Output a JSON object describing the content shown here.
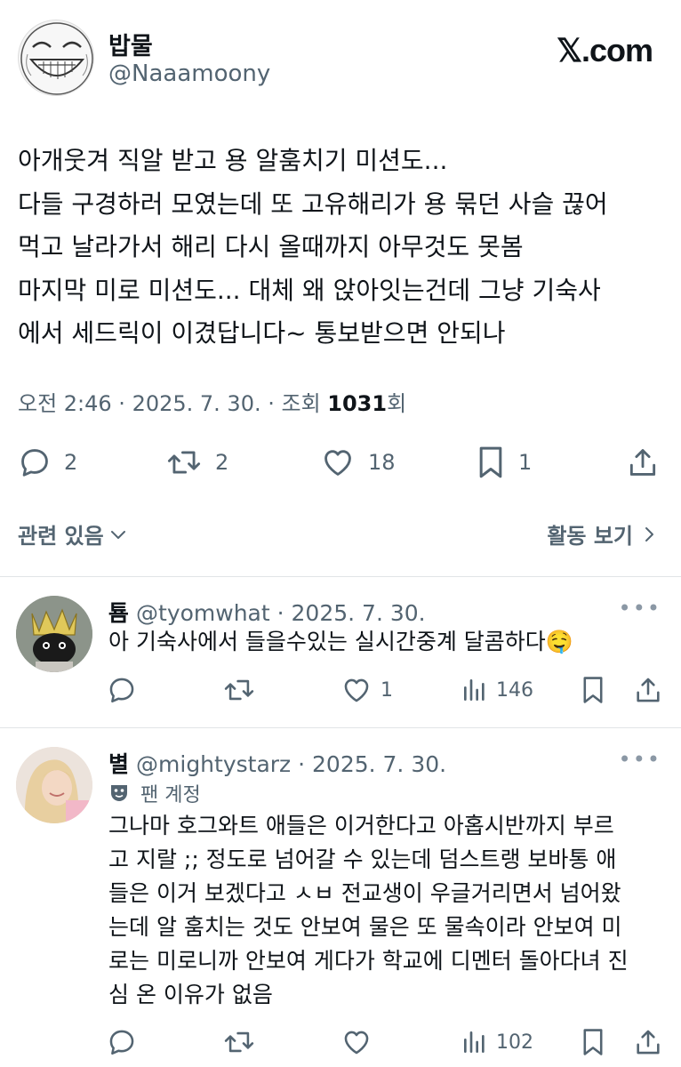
{
  "tweet": {
    "author_name": "밥물",
    "author_handle": "@Naaamoony",
    "brand": "𝕏.com",
    "body": "아개웃겨 직알 받고 용 알훔치기 미션도...\n다들 구경하러 모였는데 또 고유해리가 용 묶던 사슬 끊어\n먹고 날라가서 해리 다시 올때까지 아무것도 못봄\n마지막 미로 미션도... 대체 왜 앉아잇는건데 그냥 기숙사\n에서 세드릭이 이겼답니다~ 통보받으면 안되나",
    "meta_prefix": "오전 2:46 · 2025. 7. 30. · 조회 ",
    "views": "1031",
    "meta_suffix": "회",
    "replies": "2",
    "retweets": "2",
    "likes": "18",
    "bookmarks": "1",
    "related_label": "관련 있음",
    "activity_label": "활동 보기"
  },
  "replies": [
    {
      "name": "툠",
      "handle_date": "@tyomwhat · 2025. 7. 30.",
      "text": "아 기숙사에서 들을수있는 실시간중계 달콤하다🤤",
      "likes": "1",
      "views": "146"
    },
    {
      "name": "별",
      "handle_date": "@mightystarz · 2025. 7. 30.",
      "fan_tag": "팬 계정",
      "text": "그나마 호그와트 애들은 이거한다고 아홉시반까지 부르\n고 지랄 ;; 정도로 넘어갈 수 있는데 덤스트랭 보바통 애\n들은 이거 보겠다고 ㅅㅂ 전교생이 우글거리면서 넘어왔\n는데 알 훔치는 것도 안보여 물은 또 물속이라 안보여 미\n로는 미로니까 안보여 게다가 학교에 디멘터 돌아다녀 진\n심 온 이유가 없음",
      "likes": "",
      "views": "102"
    }
  ],
  "more_icon": "more-dots-icon",
  "colors": {
    "text": "#0f1419",
    "secondary": "#536471",
    "divider": "#e1e4e6"
  }
}
